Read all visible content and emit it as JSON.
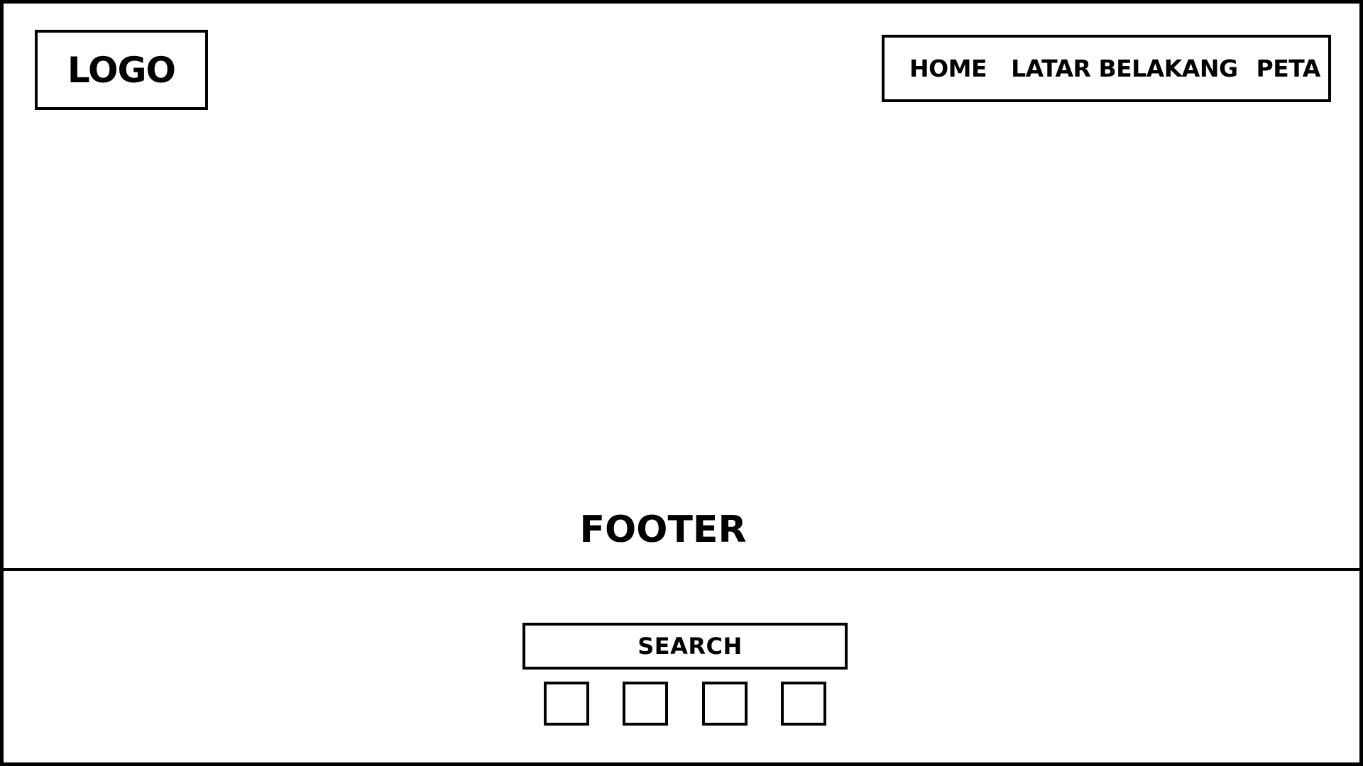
{
  "header": {
    "logo_text": "LOGO",
    "nav": {
      "home": "HOME",
      "latar_belakang": "LATAR BELAKANG",
      "peta": "PETA"
    }
  },
  "footer": {
    "label": "FOOTER",
    "search_label": "SEARCH"
  },
  "colors": {
    "stroke": "#000000",
    "background": "#ffffff"
  }
}
